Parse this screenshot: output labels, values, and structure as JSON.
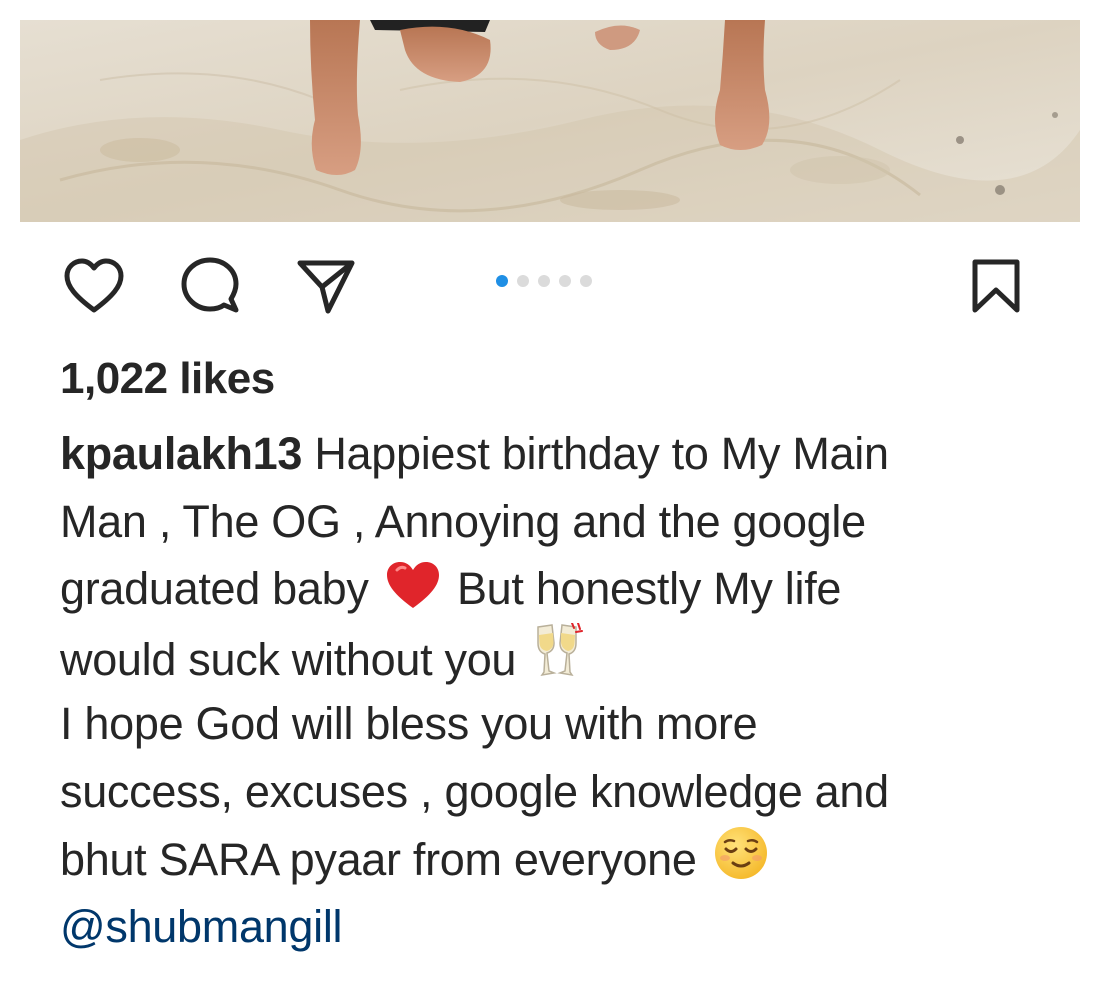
{
  "post": {
    "likes_text": "1,022 likes",
    "carousel": {
      "total": 5,
      "active_index": 0
    },
    "caption": {
      "username": "kpaulakh13",
      "line1": " Happiest birthday to My Main",
      "line2": "Man , The OG , Annoying and the google",
      "line3a": "graduated baby ",
      "line3b": " But honestly My life",
      "line4": "would suck without you ",
      "line5": "I hope God will bless you with more",
      "line6": "success, excuses , google knowledge and",
      "line7": "bhut SARA pyaar from everyone ",
      "mention": "@shubmangill"
    }
  },
  "icons": {
    "like": "heart-outline-icon",
    "comment": "speech-bubble-icon",
    "share": "paper-plane-icon",
    "save": "bookmark-icon",
    "emoji_heart": "red-heart-emoji",
    "emoji_cheers": "clinking-glasses-emoji",
    "emoji_relieved": "relieved-face-emoji"
  },
  "colors": {
    "text": "#262626",
    "mention": "#00376b",
    "active_dot": "#1f8fe5",
    "inactive_dot": "#dbdbdb",
    "heart_emoji": "#e0252b"
  }
}
